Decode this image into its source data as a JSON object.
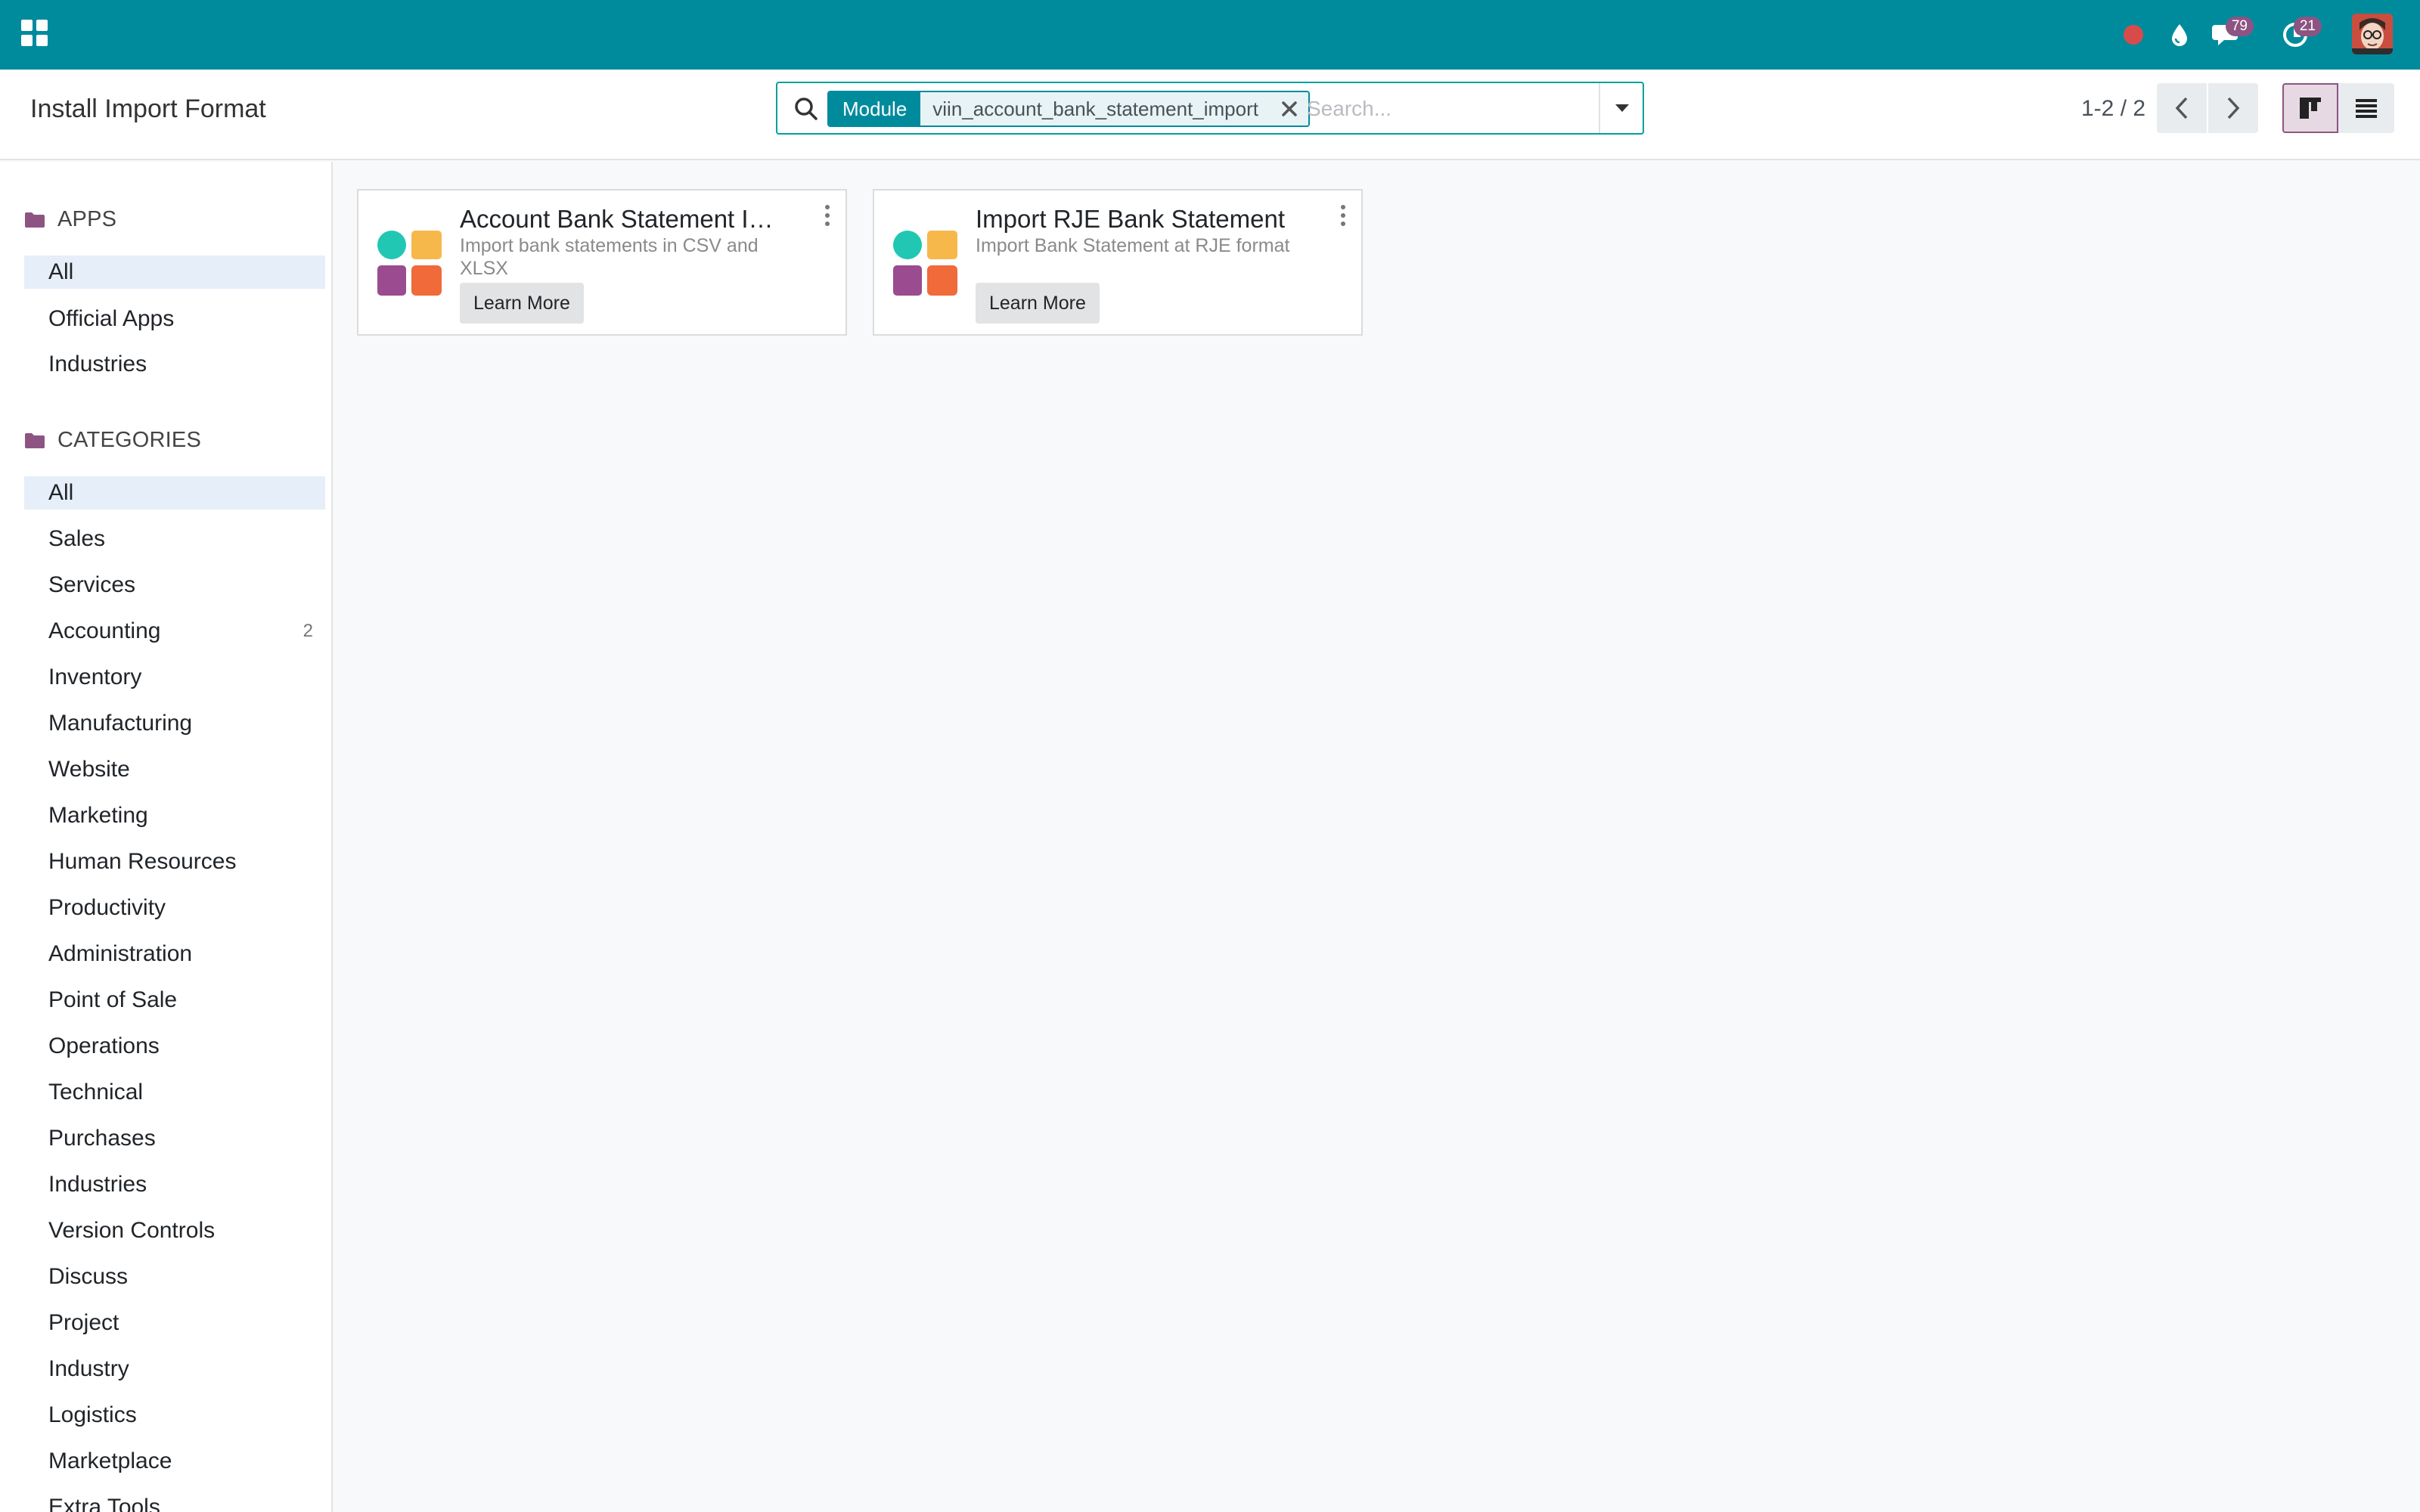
{
  "navbar": {
    "icons": {
      "apps": "apps-grid-icon",
      "record": "record-dot-icon",
      "debug": "drop-icon",
      "messages": "chat-icon",
      "activities": "clock-icon",
      "avatar": "user-avatar"
    },
    "messages_count": "79",
    "activities_count": "21"
  },
  "control_panel": {
    "title": "Install Import Format",
    "search": {
      "facet_label": "Module",
      "facet_value": "viin_account_bank_statement_import",
      "placeholder": "Search..."
    },
    "pager": "1-2 / 2"
  },
  "sidebar": {
    "apps_heading": "APPS",
    "apps": [
      {
        "label": "All",
        "active": true
      },
      {
        "label": "Official Apps"
      },
      {
        "label": "Industries"
      }
    ],
    "categories_heading": "CATEGORIES",
    "categories": [
      {
        "label": "All",
        "active": true
      },
      {
        "label": "Sales"
      },
      {
        "label": "Services"
      },
      {
        "label": "Accounting",
        "count": "2"
      },
      {
        "label": "Inventory"
      },
      {
        "label": "Manufacturing"
      },
      {
        "label": "Website"
      },
      {
        "label": "Marketing"
      },
      {
        "label": "Human Resources"
      },
      {
        "label": "Productivity"
      },
      {
        "label": "Administration"
      },
      {
        "label": "Point of Sale"
      },
      {
        "label": "Operations"
      },
      {
        "label": "Technical"
      },
      {
        "label": "Purchases"
      },
      {
        "label": "Industries"
      },
      {
        "label": "Version Controls"
      },
      {
        "label": "Discuss"
      },
      {
        "label": "Project"
      },
      {
        "label": "Industry"
      },
      {
        "label": "Logistics"
      },
      {
        "label": "Marketplace"
      },
      {
        "label": "Extra Tools"
      }
    ]
  },
  "modules": [
    {
      "title": "Account Bank Statement Import",
      "description": "Import bank statements in CSV and XLSX",
      "button": "Learn More"
    },
    {
      "title": "Import RJE Bank Statement",
      "description": "Import Bank Statement at RJE format",
      "button": "Learn More"
    }
  ],
  "colors": {
    "navbar": "#008b9c",
    "accent": "#8d5483",
    "facet": "#008b9c",
    "logo_teal": "#21c7b3",
    "logo_yellow": "#f7b84b",
    "logo_purple": "#9b4b8f",
    "logo_orange": "#f06a3a"
  }
}
